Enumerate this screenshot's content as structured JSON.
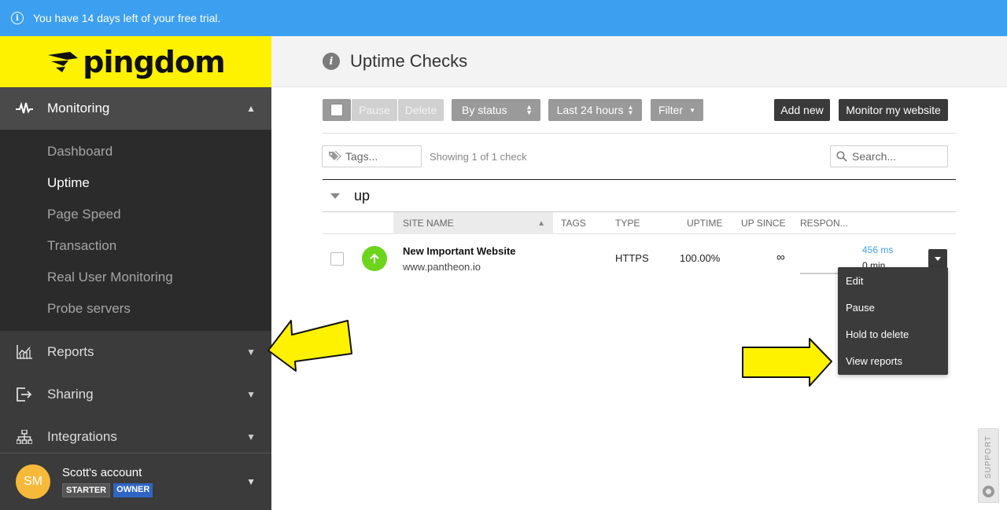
{
  "banner": {
    "text": "You have 14 days left of your free trial."
  },
  "brand": {
    "name": "pingdom",
    "colors": {
      "yellow": "#fff200",
      "blue": "#3d9ff0",
      "green": "#6dd41e"
    }
  },
  "sidebar": {
    "monitoring": {
      "label": "Monitoring",
      "items": [
        {
          "label": "Dashboard",
          "active": false
        },
        {
          "label": "Uptime",
          "active": true
        },
        {
          "label": "Page Speed",
          "active": false
        },
        {
          "label": "Transaction",
          "active": false
        },
        {
          "label": "Real User Monitoring",
          "active": false
        },
        {
          "label": "Probe servers",
          "active": false
        }
      ]
    },
    "reports": {
      "label": "Reports"
    },
    "sharing": {
      "label": "Sharing"
    },
    "integrations": {
      "label": "Integrations"
    },
    "account": {
      "initials": "SM",
      "name": "Scott's account",
      "plan": "STARTER",
      "role": "OWNER"
    }
  },
  "header": {
    "title": "Uptime Checks"
  },
  "toolbar": {
    "pause": "Pause",
    "delete": "Delete",
    "by_status": "By status",
    "last_24": "Last 24 hours",
    "filter": "Filter",
    "add_new": "Add new",
    "monitor": "Monitor my website"
  },
  "filters": {
    "tags_placeholder": "Tags...",
    "showing": "Showing 1 of 1 check",
    "search_placeholder": "Search..."
  },
  "group": {
    "name": "up"
  },
  "table": {
    "headers": [
      "SITE NAME",
      "TAGS",
      "TYPE",
      "UPTIME",
      "UP SINCE",
      "RESPON..."
    ],
    "rows": [
      {
        "name": "New Important Website",
        "url": "www.pantheon.io",
        "tags": "",
        "type": "HTTPS",
        "uptime": "100.00%",
        "up_since": "∞",
        "response_ms": "456 ms",
        "response_min": "0 min"
      }
    ]
  },
  "row_menu": [
    "Edit",
    "Pause",
    "Hold to delete",
    "View reports"
  ],
  "support": {
    "label": "SUPPORT"
  }
}
